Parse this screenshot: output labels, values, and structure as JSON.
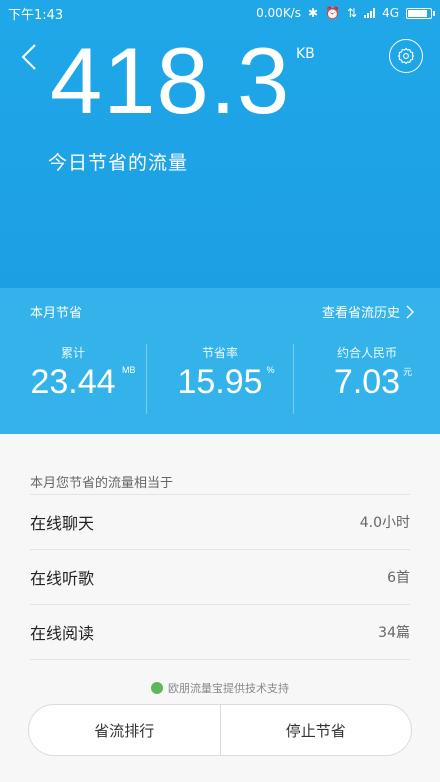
{
  "status_bar": {
    "time": "下午1:43",
    "net_speed": "0.00K/s",
    "network_type": "4G",
    "battery_level": 0.9
  },
  "hero": {
    "saved_today_value": "418.3",
    "saved_today_unit": "KB",
    "subtitle": "今日节省的流量",
    "back_icon": "back-chevron-icon",
    "settings_icon": "gear-icon"
  },
  "month": {
    "title": "本月节省",
    "history_link": "查看省流历史",
    "stats": [
      {
        "label": "累计",
        "value": "23.44",
        "unit": "MB"
      },
      {
        "label": "节省率",
        "value": "15.95",
        "unit": "%"
      },
      {
        "label": "约合人民币",
        "value": "7.03",
        "unit": "元"
      }
    ]
  },
  "equivalents": {
    "title": "本月您节省的流量相当于",
    "rows": [
      {
        "name": "在线聊天",
        "value": "4.0小时"
      },
      {
        "name": "在线听歌",
        "value": "6首"
      },
      {
        "name": "在线阅读",
        "value": "34篇"
      }
    ]
  },
  "footer": {
    "powered_by": "欧朋流量宝提供技术支持",
    "left_button": "省流排行",
    "right_button": "停止节省"
  },
  "colors": {
    "hero_blue": "#1fa7e8",
    "month_blue": "#33b3ea"
  }
}
